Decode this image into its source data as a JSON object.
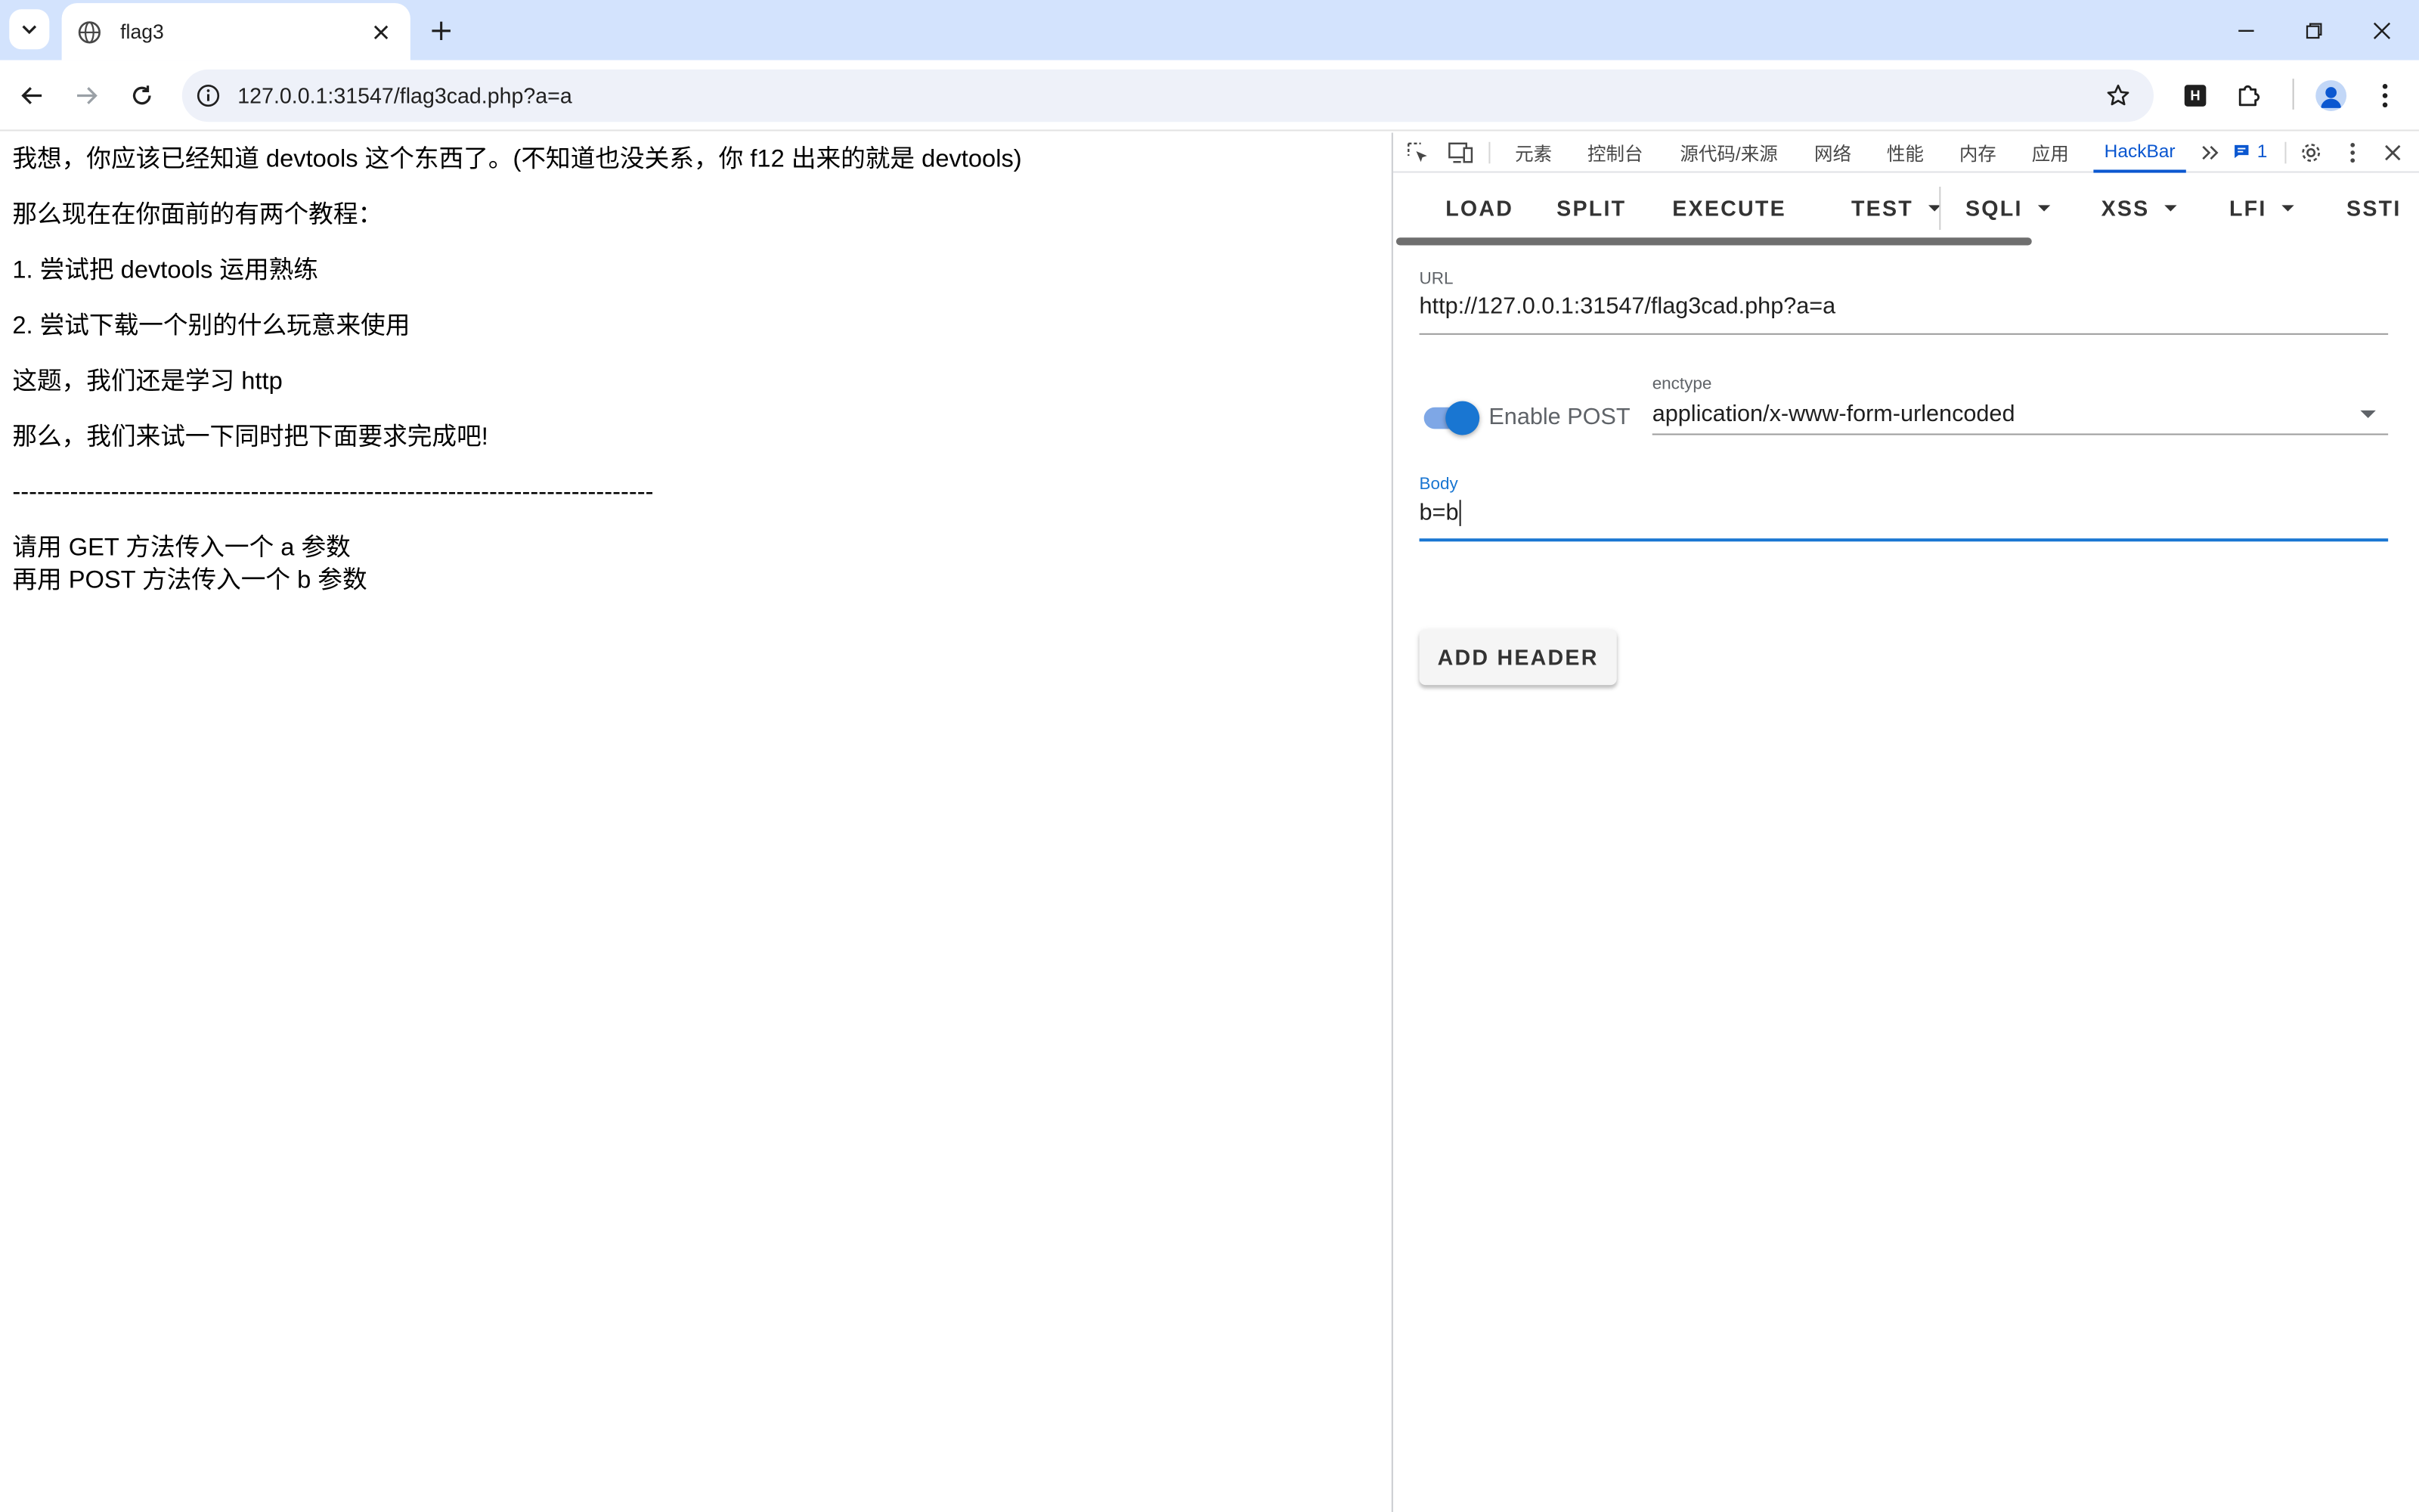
{
  "browser": {
    "tab_title": "flag3",
    "url": "127.0.0.1:31547/flag3cad.php?a=a"
  },
  "page": {
    "lines": [
      "我想，你应该已经知道 devtools 这个东西了。(不知道也没关系，你 f12 出来的就是 devtools)",
      "那么现在在你面前的有两个教程：",
      "1. 尝试把 devtools 运用熟练",
      "2. 尝试下载一个别的什么玩意来使用",
      "这题，我们还是学习 http",
      "那么，我们来试一下同时把下面要求完成吧!",
      "------------------------------------------------------------------------------",
      "请用 GET 方法传入一个 a 参数",
      "再用 POST 方法传入一个 b 参数"
    ]
  },
  "devtools": {
    "tabs": [
      "元素",
      "控制台",
      "源代码/来源",
      "网络",
      "性能",
      "内存",
      "应用",
      "HackBar"
    ],
    "active_tab": "HackBar",
    "issues_count": "1"
  },
  "hackbar": {
    "buttons": [
      "LOAD",
      "SPLIT",
      "EXECUTE",
      "TEST",
      "SQLI",
      "XSS",
      "LFI",
      "SSTI"
    ],
    "url_label": "URL",
    "url_value": "http://127.0.0.1:31547/flag3cad.php?a=a",
    "enable_post_label": "Enable POST",
    "enable_post": true,
    "enctype_label": "enctype",
    "enctype_value": "application/x-www-form-urlencoded",
    "body_label": "Body",
    "body_value": "b=b",
    "add_header_label": "ADD HEADER"
  },
  "colors": {
    "tabstrip": "#d3e3fd",
    "accent": "#1976d2",
    "devtools_active": "#0b57d0"
  }
}
